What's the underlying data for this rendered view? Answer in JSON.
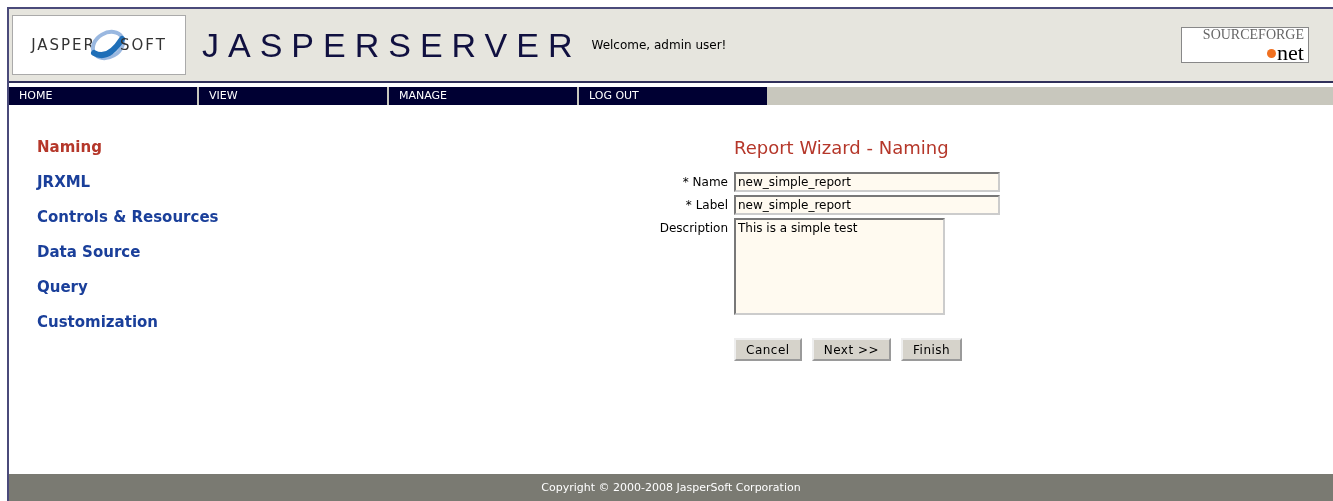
{
  "header": {
    "company_logo": {
      "left": "JASPER",
      "right": "SOFT"
    },
    "product_logo": "JASPERSERVER",
    "welcome": "Welcome, admin user!",
    "partner_logo": {
      "top": "SOURCEFORGE",
      "bottom": "net"
    }
  },
  "nav": [
    {
      "label": "HOME"
    },
    {
      "label": "VIEW"
    },
    {
      "label": "MANAGE"
    },
    {
      "label": "LOG OUT"
    }
  ],
  "steps": [
    {
      "label": "Naming",
      "selected": true
    },
    {
      "label": "JRXML",
      "selected": false
    },
    {
      "label": "Controls & Resources",
      "selected": false
    },
    {
      "label": "Data Source",
      "selected": false
    },
    {
      "label": "Query",
      "selected": false
    },
    {
      "label": "Customization",
      "selected": false
    }
  ],
  "form": {
    "title": "Report Wizard - Naming",
    "fields": [
      {
        "kind": "text",
        "label": "* Name",
        "value": "new_simple_report"
      },
      {
        "kind": "textline",
        "label": "* Label",
        "value": "new_simple_report"
      },
      {
        "kind": "textarea",
        "label": "Description",
        "value": "This is a simple test"
      }
    ],
    "buttons": [
      "Cancel",
      "Next >>",
      "Finish"
    ]
  },
  "footer": "Copyright © 2000-2008 JasperSoft Corporation"
}
